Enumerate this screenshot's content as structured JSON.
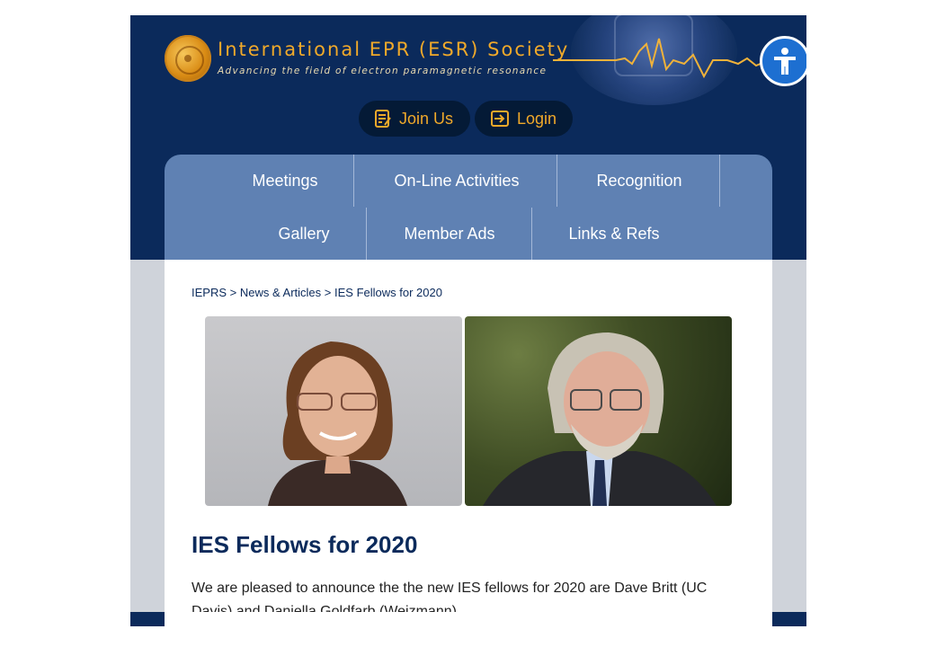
{
  "site": {
    "title": "International EPR (ESR) Society",
    "tagline": "Advancing the field of electron paramagnetic resonance"
  },
  "auth": {
    "join_label": "Join Us",
    "login_label": "Login"
  },
  "nav": {
    "row1": [
      "Meetings",
      "On-Line Activities",
      "Recognition"
    ],
    "row2": [
      "Gallery",
      "Member Ads",
      "Links & Refs"
    ]
  },
  "breadcrumb": {
    "home": "IEPRS",
    "section": "News & Articles",
    "current": "IES Fellows for 2020",
    "separator": ">"
  },
  "article": {
    "title": "IES Fellows for 2020",
    "body": "We are pleased to announce the the new IES fellows for 2020 are Dave Britt (UC Davis) and Daniella Goldfarb  (Weizmann) ."
  },
  "icons": {
    "accessibility": "accessibility-icon",
    "join": "signup-form-icon",
    "login": "login-arrow-icon"
  },
  "colors": {
    "header_bg": "#0b2a5b",
    "nav_bg": "#5f81b3",
    "accent_orange": "#f0a92a",
    "accessibility_blue": "#1d6fd1"
  }
}
